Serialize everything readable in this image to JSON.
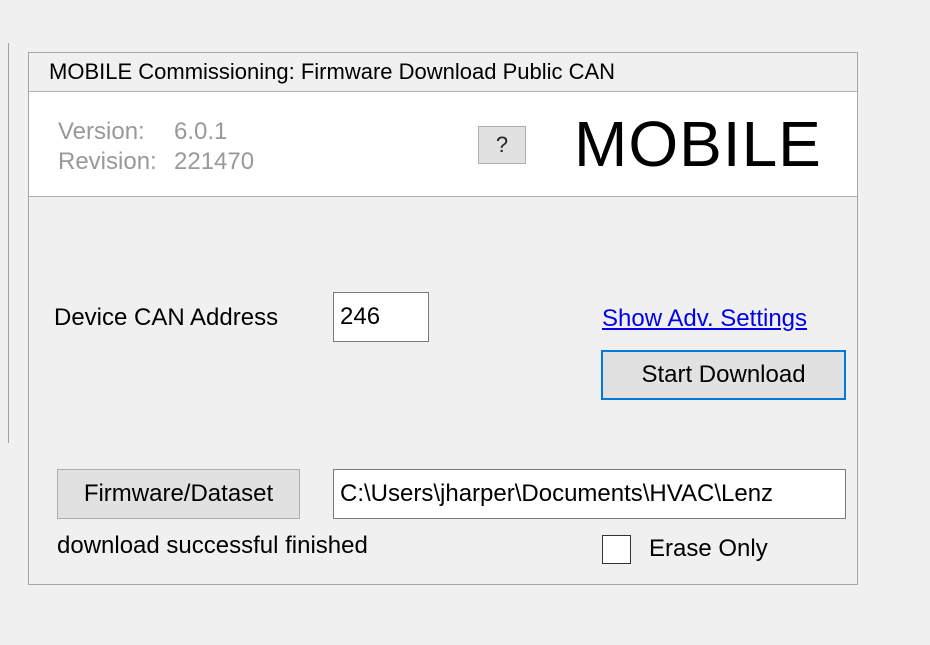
{
  "window": {
    "title": "MOBILE Commissioning: Firmware Download Public CAN"
  },
  "header": {
    "version_label": "Version:",
    "version_value": "6.0.1",
    "revision_label": "Revision:",
    "revision_value": "221470",
    "help_label": "?",
    "logo_text": "MOBILE"
  },
  "form": {
    "can_address_label": "Device CAN Address",
    "can_address_value": "246",
    "adv_settings_link": "Show Adv. Settings",
    "start_download_label": "Start Download",
    "firmware_button_label": "Firmware/Dataset",
    "firmware_path_value": "C:\\Users\\jharper\\Documents\\HVAC\\Lenz",
    "status_text": "download successful finished",
    "erase_only_label": "Erase Only",
    "erase_only_checked": false
  },
  "colors": {
    "link": "#0000ee",
    "focus_border": "#0078d7",
    "version_text": "#999999"
  }
}
